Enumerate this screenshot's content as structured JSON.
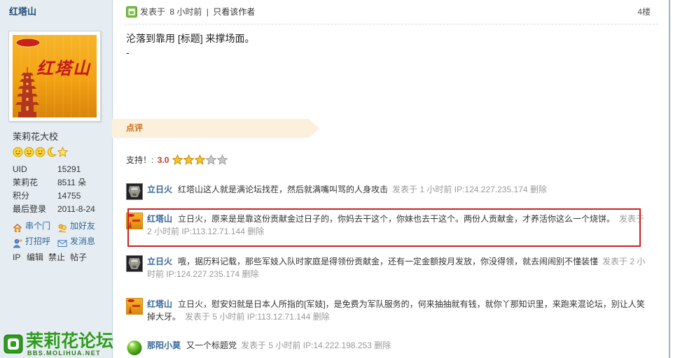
{
  "sidebar": {
    "username": "红塔山",
    "avatar": {
      "brand_text": "红塔山"
    },
    "rank_title": "茉莉花大校",
    "rank_icons": [
      "smile-icon",
      "smile-icon",
      "smile-icon",
      "moon-icon",
      "star-icon"
    ],
    "stats": [
      {
        "label": "UID",
        "value": "15291"
      },
      {
        "label": "茉莉花",
        "value": "8511 朵"
      },
      {
        "label": "积分",
        "value": "14755"
      },
      {
        "label": "最后登录",
        "value": "2011-8-24"
      }
    ],
    "actions": [
      {
        "label": "串个门",
        "icon": "house-icon"
      },
      {
        "label": "加好友",
        "icon": "add-friend-icon"
      },
      {
        "label": "打招呼",
        "icon": "greet-icon"
      },
      {
        "label": "发消息",
        "icon": "envelope-icon"
      }
    ],
    "admin_links": [
      "IP",
      "编辑",
      "禁止",
      "帖子"
    ]
  },
  "logo": {
    "name": "茉莉花论坛",
    "domain": "BBS.MOLIHUA.NET"
  },
  "post": {
    "status_icon": "online-status-icon",
    "posted_label": "发表于",
    "posted_time": "8 小时前",
    "separator": "|",
    "only_author_link": "只看该作者",
    "floor": "4楼",
    "content": "沦落到靠用 [标题] 来撑场面。",
    "trailing_line": "-"
  },
  "comments_section": {
    "tab_label": "点评",
    "support_label": "支持！:",
    "score": "3.0",
    "stars_filled": 3,
    "stars_total": 5
  },
  "comments": [
    {
      "author": "立日火",
      "avatar_icon": "robot-emblem-avatar",
      "text": "红塔山这人就是满论坛找茬，然后就满嘴叫骂的人身攻击",
      "posted_label": "发表于",
      "time": "1 小时前",
      "ip": "IP:124.227.235.174",
      "delete_label": "删除",
      "highlighted": false
    },
    {
      "author": "红塔山",
      "avatar_icon": "cigarette-pack-avatar",
      "text": "立日火，原来是是靠这份贡献金过日子的，你妈去干这个，你妹也去干这个。两份人贡献金，才养活你这么一个烧饼。",
      "posted_label": "发表于",
      "time": "2 小时前",
      "ip": "IP:113.12.71.144",
      "delete_label": "删除",
      "highlighted": true
    },
    {
      "author": "立日火",
      "avatar_icon": "robot-emblem-avatar",
      "text": "哦，据历料记载，那些军妓入队时家庭是得领份贡献金，还有一定金额按月发放，你没得领，就去闹闹别不懂装懂",
      "posted_label": "发表于",
      "time": "2 小时前",
      "ip": "IP:124.227.235.174",
      "delete_label": "删除",
      "highlighted": false
    },
    {
      "author": "红塔山",
      "avatar_icon": "cigarette-pack-avatar",
      "text": "立日火，慰安妇就是日本人所指的[军妓]，是免费为军队服务的，何来抽抽就有钱，就你丫那知识里，来跑来混论坛，别让人笑掉大牙。",
      "posted_label": "发表于",
      "time": "5 小时前",
      "ip": "IP:113.12.71.144",
      "delete_label": "删除",
      "highlighted": false
    },
    {
      "author": "那阳小莫",
      "avatar_icon": "green-ball-avatar",
      "text": "又一个标题党",
      "posted_label": "发表于",
      "time": "5 小时前",
      "ip": "IP:14.222.198.253",
      "delete_label": "删除",
      "highlighted": false
    }
  ],
  "colors": {
    "sidebar_bg": "#e5edf2",
    "author_link": "#336699",
    "meta_text": "#999999",
    "highlight_border": "#cc1f1f",
    "tab_text": "#c8731e",
    "tab_bg": "#fcefdc",
    "score": "#c0392b",
    "logo_green": "#2d9b1e"
  }
}
